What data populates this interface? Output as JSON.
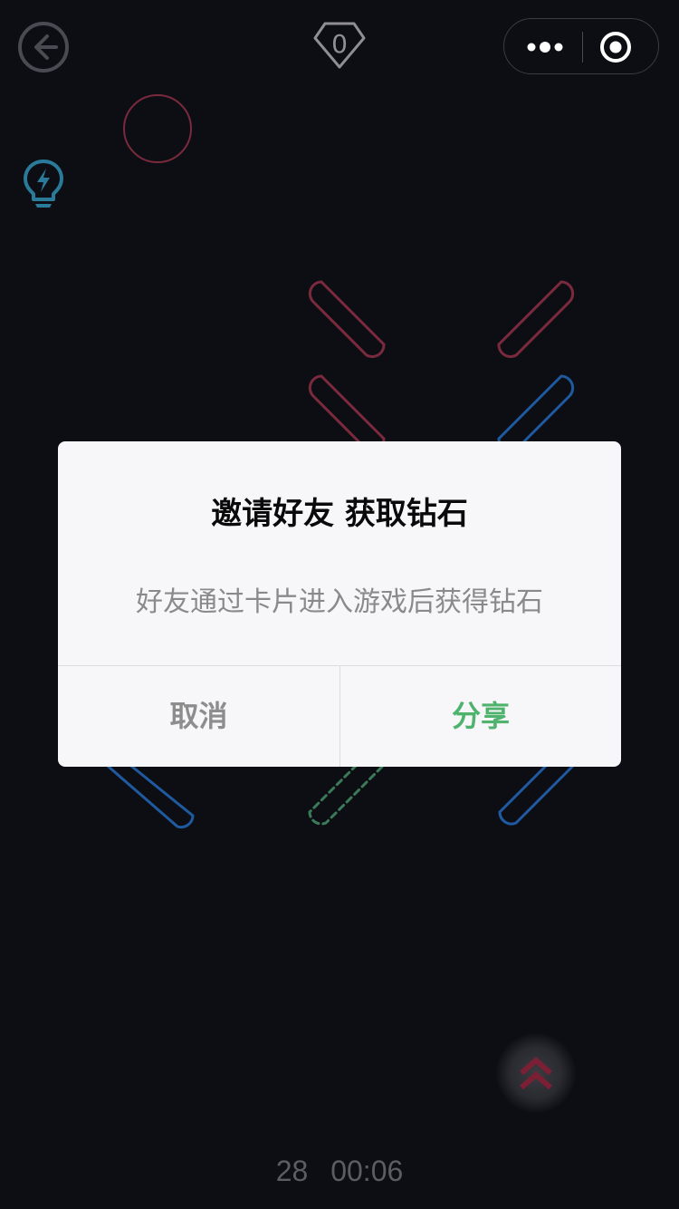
{
  "header": {
    "back_icon": "arrow-left-circle-icon",
    "diamond_icon": "diamond-icon",
    "diamond_count": "0",
    "capsule": {
      "more_icon": "more-dots-icon",
      "close_icon": "target-circle-icon"
    }
  },
  "hint_icon": "lightbulb-bolt-icon",
  "boost_icon": "double-chevron-up-icon",
  "footer": {
    "level": "28",
    "timer": "00:06"
  },
  "dialog": {
    "title": "邀请好友 获取钻石",
    "content": "好友通过卡片进入游戏后获得钻石",
    "cancel_label": "取消",
    "confirm_label": "分享"
  },
  "colors": {
    "background": "#0d0e14",
    "red_piece": "#7a2a3c",
    "blue_piece": "#1f5aa0",
    "green_piece": "#3b7a58",
    "hint": "#2a7a9a",
    "boost": "#7a1f34",
    "share": "#4fb36e"
  }
}
